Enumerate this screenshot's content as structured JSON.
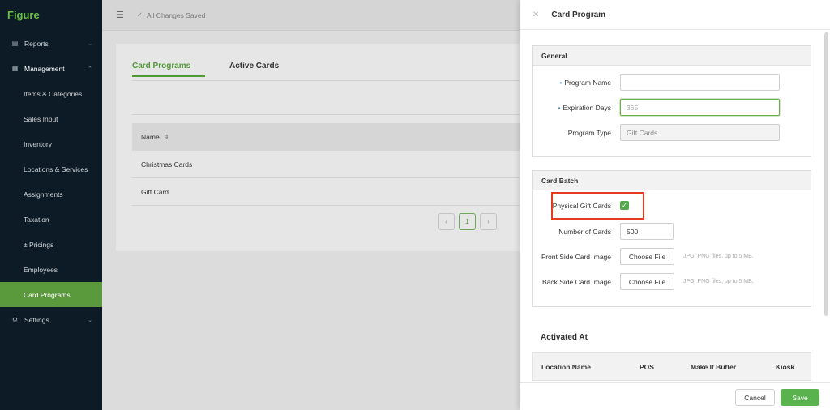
{
  "brand": "Figure",
  "sidebar": {
    "top_items": [
      {
        "label": "Reports",
        "icon": "report-icon"
      },
      {
        "label": "Management",
        "icon": "management-icon"
      }
    ],
    "sub_items": [
      "Items & Categories",
      "Sales Input",
      "Inventory",
      "Locations & Services",
      "Assignments",
      "Taxation",
      "± Pricings",
      "Employees",
      "Card Programs"
    ],
    "settings": "Settings",
    "active": "Card Programs"
  },
  "topbar": {
    "status": "All Changes Saved"
  },
  "main": {
    "tabs": [
      "Card Programs",
      "Active Cards"
    ],
    "table": {
      "header": "Name",
      "rows": [
        "Christmas Cards",
        "Gift Card"
      ]
    },
    "pagination": {
      "prev": "‹",
      "current": "1",
      "next": "›"
    }
  },
  "drawer": {
    "title": "Card Program",
    "general": {
      "heading": "General",
      "program_name_label": "Program Name",
      "program_name_value": "",
      "expiration_days_label": "Expiration Days",
      "expiration_days_placeholder": "365",
      "program_type_label": "Program Type",
      "program_type_value": "Gift Cards"
    },
    "card_batch": {
      "heading": "Card Batch",
      "physical_label": "Physical Gift Cards",
      "physical_checked": true,
      "num_cards_label": "Number of Cards",
      "num_cards_value": "500",
      "front_label": "Front Side Card Image",
      "back_label": "Back Side Card Image",
      "choose_file": "Choose File",
      "file_hint": "JPG, PNG files, up to 5 MB."
    },
    "activated": {
      "title": "Activated At",
      "columns": [
        "Location Name",
        "POS",
        "Make It Butter",
        "Kiosk"
      ]
    },
    "footer": {
      "cancel": "Cancel",
      "save": "Save"
    }
  },
  "colors": {
    "accent": "#5ab24f",
    "sidebar_bg": "#0d1b26",
    "highlight": "#e53a1e",
    "required_dot": "#3b8fd6"
  }
}
